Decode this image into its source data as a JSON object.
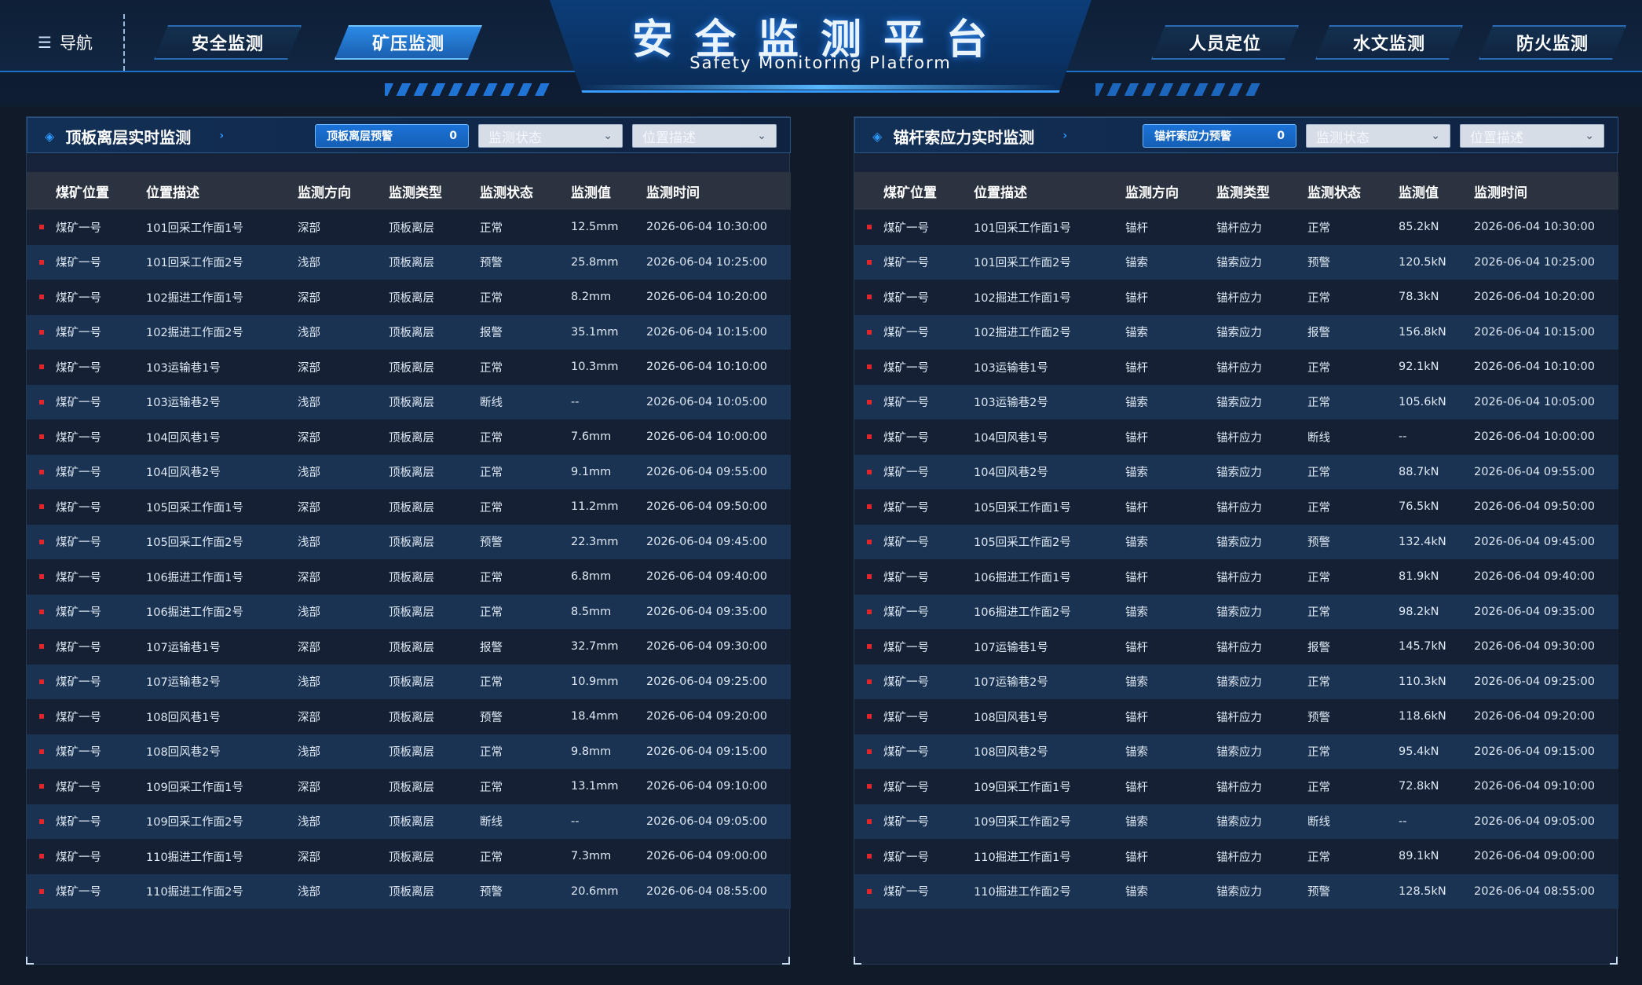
{
  "header": {
    "nav_label": "导航",
    "title": "安全监测平台",
    "subtitle": "Safety Monitoring Platform",
    "left_tabs": [
      {
        "label": "安全监测",
        "active": false
      },
      {
        "label": "矿压监测",
        "active": true
      }
    ],
    "right_tabs": [
      {
        "label": "人员定位"
      },
      {
        "label": "水文监测"
      },
      {
        "label": "防火监测"
      }
    ]
  },
  "columns": [
    "煤矿位置",
    "位置描述",
    "监测方向",
    "监测类型",
    "监测状态",
    "监测值",
    "监测时间"
  ],
  "left_panel": {
    "title": "顶板离层实时监测",
    "alert_label": "顶板离层预警",
    "alert_count": "0",
    "status_select": "监测状态",
    "position_select": "位置描述",
    "rows": [
      [
        "煤矿一号",
        "101回采工作面1号",
        "深部",
        "顶板离层",
        "正常",
        "12.5mm",
        "2026-06-04 10:30:00"
      ],
      [
        "煤矿一号",
        "101回采工作面2号",
        "浅部",
        "顶板离层",
        "预警",
        "25.8mm",
        "2026-06-04 10:25:00"
      ],
      [
        "煤矿一号",
        "102掘进工作面1号",
        "深部",
        "顶板离层",
        "正常",
        "8.2mm",
        "2026-06-04 10:20:00"
      ],
      [
        "煤矿一号",
        "102掘进工作面2号",
        "浅部",
        "顶板离层",
        "报警",
        "35.1mm",
        "2026-06-04 10:15:00"
      ],
      [
        "煤矿一号",
        "103运输巷1号",
        "深部",
        "顶板离层",
        "正常",
        "10.3mm",
        "2026-06-04 10:10:00"
      ],
      [
        "煤矿一号",
        "103运输巷2号",
        "浅部",
        "顶板离层",
        "断线",
        "--",
        "2026-06-04 10:05:00"
      ],
      [
        "煤矿一号",
        "104回风巷1号",
        "深部",
        "顶板离层",
        "正常",
        "7.6mm",
        "2026-06-04 10:00:00"
      ],
      [
        "煤矿一号",
        "104回风巷2号",
        "浅部",
        "顶板离层",
        "正常",
        "9.1mm",
        "2026-06-04 09:55:00"
      ],
      [
        "煤矿一号",
        "105回采工作面1号",
        "深部",
        "顶板离层",
        "正常",
        "11.2mm",
        "2026-06-04 09:50:00"
      ],
      [
        "煤矿一号",
        "105回采工作面2号",
        "浅部",
        "顶板离层",
        "预警",
        "22.3mm",
        "2026-06-04 09:45:00"
      ],
      [
        "煤矿一号",
        "106掘进工作面1号",
        "深部",
        "顶板离层",
        "正常",
        "6.8mm",
        "2026-06-04 09:40:00"
      ],
      [
        "煤矿一号",
        "106掘进工作面2号",
        "浅部",
        "顶板离层",
        "正常",
        "8.5mm",
        "2026-06-04 09:35:00"
      ],
      [
        "煤矿一号",
        "107运输巷1号",
        "深部",
        "顶板离层",
        "报警",
        "32.7mm",
        "2026-06-04 09:30:00"
      ],
      [
        "煤矿一号",
        "107运输巷2号",
        "浅部",
        "顶板离层",
        "正常",
        "10.9mm",
        "2026-06-04 09:25:00"
      ],
      [
        "煤矿一号",
        "108回风巷1号",
        "深部",
        "顶板离层",
        "预警",
        "18.4mm",
        "2026-06-04 09:20:00"
      ],
      [
        "煤矿一号",
        "108回风巷2号",
        "浅部",
        "顶板离层",
        "正常",
        "9.8mm",
        "2026-06-04 09:15:00"
      ],
      [
        "煤矿一号",
        "109回采工作面1号",
        "深部",
        "顶板离层",
        "正常",
        "13.1mm",
        "2026-06-04 09:10:00"
      ],
      [
        "煤矿一号",
        "109回采工作面2号",
        "浅部",
        "顶板离层",
        "断线",
        "--",
        "2026-06-04 09:05:00"
      ],
      [
        "煤矿一号",
        "110掘进工作面1号",
        "深部",
        "顶板离层",
        "正常",
        "7.3mm",
        "2026-06-04 09:00:00"
      ],
      [
        "煤矿一号",
        "110掘进工作面2号",
        "浅部",
        "顶板离层",
        "预警",
        "20.6mm",
        "2026-06-04 08:55:00"
      ]
    ]
  },
  "right_panel": {
    "title": "锚杆索应力实时监测",
    "alert_label": "锚杆索应力预警",
    "alert_count": "0",
    "status_select": "监测状态",
    "position_select": "位置描述",
    "rows": [
      [
        "煤矿一号",
        "101回采工作面1号",
        "锚杆",
        "锚杆应力",
        "正常",
        "85.2kN",
        "2026-06-04 10:30:00"
      ],
      [
        "煤矿一号",
        "101回采工作面2号",
        "锚索",
        "锚索应力",
        "预警",
        "120.5kN",
        "2026-06-04 10:25:00"
      ],
      [
        "煤矿一号",
        "102掘进工作面1号",
        "锚杆",
        "锚杆应力",
        "正常",
        "78.3kN",
        "2026-06-04 10:20:00"
      ],
      [
        "煤矿一号",
        "102掘进工作面2号",
        "锚索",
        "锚索应力",
        "报警",
        "156.8kN",
        "2026-06-04 10:15:00"
      ],
      [
        "煤矿一号",
        "103运输巷1号",
        "锚杆",
        "锚杆应力",
        "正常",
        "92.1kN",
        "2026-06-04 10:10:00"
      ],
      [
        "煤矿一号",
        "103运输巷2号",
        "锚索",
        "锚索应力",
        "正常",
        "105.6kN",
        "2026-06-04 10:05:00"
      ],
      [
        "煤矿一号",
        "104回风巷1号",
        "锚杆",
        "锚杆应力",
        "断线",
        "--",
        "2026-06-04 10:00:00"
      ],
      [
        "煤矿一号",
        "104回风巷2号",
        "锚索",
        "锚索应力",
        "正常",
        "88.7kN",
        "2026-06-04 09:55:00"
      ],
      [
        "煤矿一号",
        "105回采工作面1号",
        "锚杆",
        "锚杆应力",
        "正常",
        "76.5kN",
        "2026-06-04 09:50:00"
      ],
      [
        "煤矿一号",
        "105回采工作面2号",
        "锚索",
        "锚索应力",
        "预警",
        "132.4kN",
        "2026-06-04 09:45:00"
      ],
      [
        "煤矿一号",
        "106掘进工作面1号",
        "锚杆",
        "锚杆应力",
        "正常",
        "81.9kN",
        "2026-06-04 09:40:00"
      ],
      [
        "煤矿一号",
        "106掘进工作面2号",
        "锚索",
        "锚索应力",
        "正常",
        "98.2kN",
        "2026-06-04 09:35:00"
      ],
      [
        "煤矿一号",
        "107运输巷1号",
        "锚杆",
        "锚杆应力",
        "报警",
        "145.7kN",
        "2026-06-04 09:30:00"
      ],
      [
        "煤矿一号",
        "107运输巷2号",
        "锚索",
        "锚索应力",
        "正常",
        "110.3kN",
        "2026-06-04 09:25:00"
      ],
      [
        "煤矿一号",
        "108回风巷1号",
        "锚杆",
        "锚杆应力",
        "预警",
        "118.6kN",
        "2026-06-04 09:20:00"
      ],
      [
        "煤矿一号",
        "108回风巷2号",
        "锚索",
        "锚索应力",
        "正常",
        "95.4kN",
        "2026-06-04 09:15:00"
      ],
      [
        "煤矿一号",
        "109回采工作面1号",
        "锚杆",
        "锚杆应力",
        "正常",
        "72.8kN",
        "2026-06-04 09:10:00"
      ],
      [
        "煤矿一号",
        "109回采工作面2号",
        "锚索",
        "锚索应力",
        "断线",
        "--",
        "2026-06-04 09:05:00"
      ],
      [
        "煤矿一号",
        "110掘进工作面1号",
        "锚杆",
        "锚杆应力",
        "正常",
        "89.1kN",
        "2026-06-04 09:00:00"
      ],
      [
        "煤矿一号",
        "110掘进工作面2号",
        "锚索",
        "锚索应力",
        "预警",
        "128.5kN",
        "2026-06-04 08:55:00"
      ]
    ]
  },
  "colors": {
    "background": "#111a29",
    "accent": "#2e9bff",
    "row_dot": "#e0262b",
    "active_tab": "#2b8ae6"
  },
  "icons": {
    "nav": "menu-icon",
    "panel_marker": "diamond-icon",
    "panel_arrow": "chevron-right-icon",
    "select": "chevron-down-icon"
  }
}
